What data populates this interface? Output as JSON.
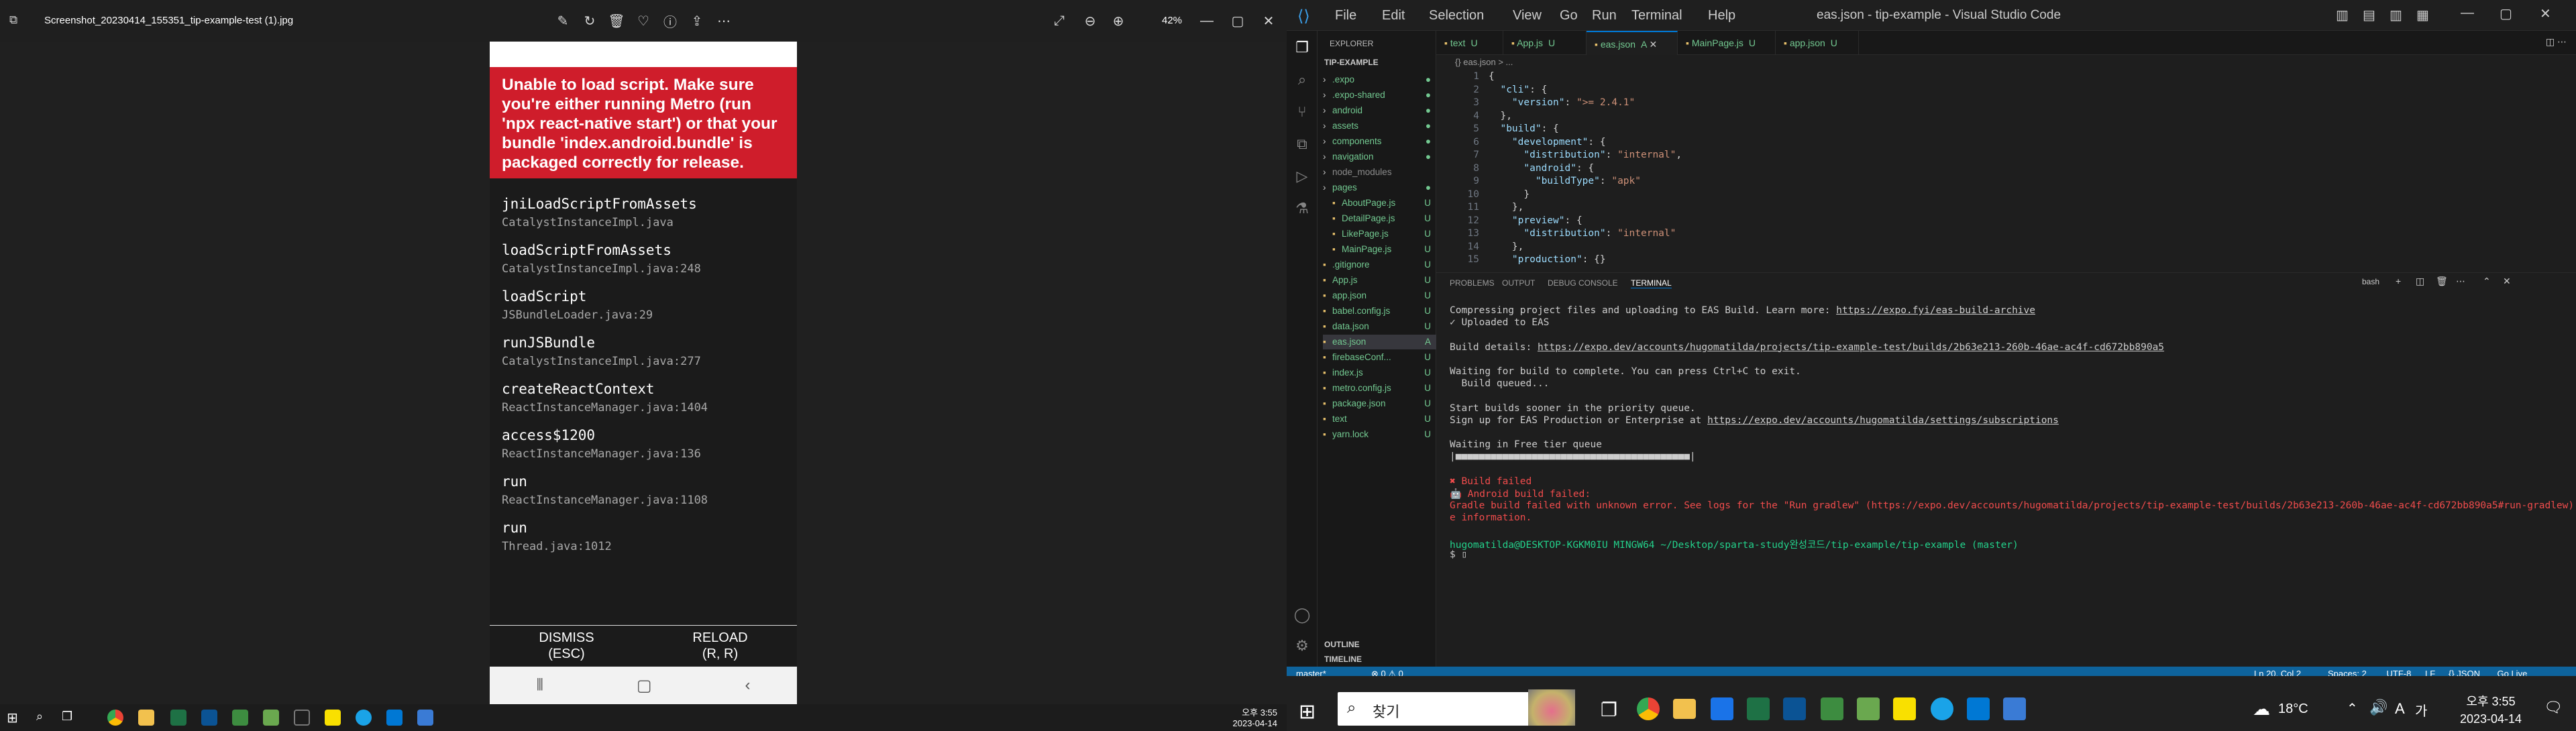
{
  "viewer": {
    "filename": "Screenshot_20230414_155351_tip-example-test (1).jpg",
    "zoom": "42%",
    "error_text": "Unable to load script. Make sure you're either running Metro (run 'npx react-native start') or that your bundle 'index.android.bundle' is packaged correctly for release.",
    "frames": [
      {
        "fn": "jniLoadScriptFromAssets",
        "loc": "CatalystInstanceImpl.java"
      },
      {
        "fn": "loadScriptFromAssets",
        "loc": "CatalystInstanceImpl.java:248"
      },
      {
        "fn": "loadScript",
        "loc": "JSBundleLoader.java:29"
      },
      {
        "fn": "runJSBundle",
        "loc": "CatalystInstanceImpl.java:277"
      },
      {
        "fn": "createReactContext",
        "loc": "ReactInstanceManager.java:1404"
      },
      {
        "fn": "access$1200",
        "loc": "ReactInstanceManager.java:136"
      },
      {
        "fn": "run",
        "loc": "ReactInstanceManager.java:1108"
      },
      {
        "fn": "run",
        "loc": "Thread.java:1012"
      }
    ],
    "dismiss": "DISMISS",
    "dismiss_key": "(ESC)",
    "reload": "RELOAD",
    "reload_key": "(R, R)",
    "clock_time": "오후 3:55",
    "clock_date": "2023-04-14"
  },
  "vscode": {
    "title": "eas.json - tip-example - Visual Studio Code",
    "menus": [
      "File",
      "Edit",
      "Selection",
      "View",
      "Go",
      "Run",
      "Terminal",
      "Help"
    ],
    "explorer_title": "EXPLORER",
    "project": "TIP-EXAMPLE",
    "explorer_items": [
      {
        "name": ".expo",
        "badge": "●",
        "color": "#73c991",
        "folder": true
      },
      {
        "name": ".expo-shared",
        "badge": "●",
        "color": "#73c991",
        "folder": true
      },
      {
        "name": "android",
        "badge": "●",
        "color": "#73c991",
        "folder": true
      },
      {
        "name": "assets",
        "badge": "●",
        "color": "#73c991",
        "folder": true
      },
      {
        "name": "components",
        "badge": "●",
        "color": "#73c991",
        "folder": true
      },
      {
        "name": "navigation",
        "badge": "●",
        "color": "#73c991",
        "folder": true
      },
      {
        "name": "node_modules",
        "badge": "",
        "color": "#8c8c8c",
        "folder": true
      },
      {
        "name": "pages",
        "badge": "●",
        "color": "#73c991",
        "folder": true
      },
      {
        "name": "AboutPage.js",
        "badge": "U",
        "color": "#73c991",
        "folder": false,
        "indent": true
      },
      {
        "name": "DetailPage.js",
        "badge": "U",
        "color": "#73c991",
        "folder": false,
        "indent": true
      },
      {
        "name": "LikePage.js",
        "badge": "U",
        "color": "#73c991",
        "folder": false,
        "indent": true
      },
      {
        "name": "MainPage.js",
        "badge": "U",
        "color": "#73c991",
        "folder": false,
        "indent": true
      },
      {
        "name": ".gitignore",
        "badge": "U",
        "color": "#73c991",
        "folder": false
      },
      {
        "name": "App.js",
        "badge": "U",
        "color": "#73c991",
        "folder": false
      },
      {
        "name": "app.json",
        "badge": "U",
        "color": "#73c991",
        "folder": false
      },
      {
        "name": "babel.config.js",
        "badge": "U",
        "color": "#73c991",
        "folder": false
      },
      {
        "name": "data.json",
        "badge": "U",
        "color": "#73c991",
        "folder": false
      },
      {
        "name": "eas.json",
        "badge": "A",
        "color": "#73c991",
        "folder": false,
        "active": true
      },
      {
        "name": "firebaseConf...",
        "badge": "U",
        "color": "#73c991",
        "folder": false
      },
      {
        "name": "index.js",
        "badge": "U",
        "color": "#73c991",
        "folder": false
      },
      {
        "name": "metro.config.js",
        "badge": "U",
        "color": "#73c991",
        "folder": false
      },
      {
        "name": "package.json",
        "badge": "U",
        "color": "#73c991",
        "folder": false
      },
      {
        "name": "text",
        "badge": "U",
        "color": "#73c991",
        "folder": false
      },
      {
        "name": "yarn.lock",
        "badge": "U",
        "color": "#73c991",
        "folder": false
      }
    ],
    "outline": "OUTLINE",
    "timeline": "TIMELINE",
    "tabs": [
      {
        "name": "text",
        "badge": "U"
      },
      {
        "name": "App.js",
        "badge": "U"
      },
      {
        "name": "eas.json",
        "badge": "A",
        "active": true
      },
      {
        "name": "MainPage.js",
        "badge": "U"
      },
      {
        "name": "app.json",
        "badge": "U"
      }
    ],
    "breadcrumb": "{} eas.json > ...",
    "code": [
      "{",
      "  \"cli\": {",
      "    \"version\": \">= 2.4.1\"",
      "  },",
      "  \"build\": {",
      "    \"development\": {",
      "      \"distribution\": \"internal\",",
      "      \"android\": {",
      "        \"buildType\": \"apk\"",
      "      }",
      "    },",
      "    \"preview\": {",
      "      \"distribution\": \"internal\"",
      "    },",
      "    \"production\": {}"
    ],
    "panel_tabs": [
      "PROBLEMS",
      "OUTPUT",
      "DEBUG CONSOLE",
      "TERMINAL"
    ],
    "terminal_shell": "bash",
    "terminal": [
      {
        "t": "Compressing project files and uploading to EAS Build. Learn more: ",
        "link": "https://expo.fyi/eas-build-archive"
      },
      {
        "t": "✓ Uploaded to EAS"
      },
      {
        "t": ""
      },
      {
        "t": "Build details: ",
        "link": "https://expo.dev/accounts/hugomatilda/projects/tip-example-test/builds/2b63e213-260b-46ae-ac4f-cd672bb890a5"
      },
      {
        "t": ""
      },
      {
        "t": "Waiting for build to complete. You can press Ctrl+C to exit."
      },
      {
        "t": "  Build queued..."
      },
      {
        "t": ""
      },
      {
        "t": "Start builds sooner in the priority queue."
      },
      {
        "t": "Sign up for EAS Production or Enterprise at ",
        "link": "https://expo.dev/accounts/hugomatilda/settings/subscriptions"
      },
      {
        "t": ""
      },
      {
        "t": "Waiting in Free tier queue"
      },
      {
        "t": "|■■■■■■■■■■■■■■■■■■■■■■■■■■■■■■■■■■■■■■■■|"
      },
      {
        "t": ""
      },
      {
        "t": "✖ Build failed",
        "color": "#f14c4c"
      },
      {
        "t": "🤖 Android build failed:",
        "color": "#f14c4c"
      },
      {
        "t": "Gradle build failed with unknown error. See logs for the \"Run gradlew\" (https://expo.dev/accounts/hugomatilda/projects/tip-example-test/builds/2b63e213-260b-46ae-ac4f-cd672bb890a5#run-gradlew) phase for mor",
        "color": "#f14c4c"
      },
      {
        "t": "e information.",
        "color": "#f14c4c"
      },
      {
        "t": ""
      },
      {
        "t": "hugomatilda@DESKTOP-KGKM0IU MINGW64 ~/Desktop/sparta-study완성코드/tip-example/tip-example (master)",
        "prompt": true
      },
      {
        "t": "$ ▯"
      }
    ],
    "status_left": [
      "master*",
      "⊗ 0 ⚠ 0"
    ],
    "status_right": [
      "Ln 20, Col 2",
      "Spaces: 2",
      "UTF-8",
      "LF",
      "{} JSON",
      "Go Live"
    ]
  },
  "taskbar": {
    "search": "찾기",
    "weather": "18°C",
    "lang": "A",
    "ime": "가",
    "time": "오후 3:55",
    "date": "2023-04-14"
  }
}
